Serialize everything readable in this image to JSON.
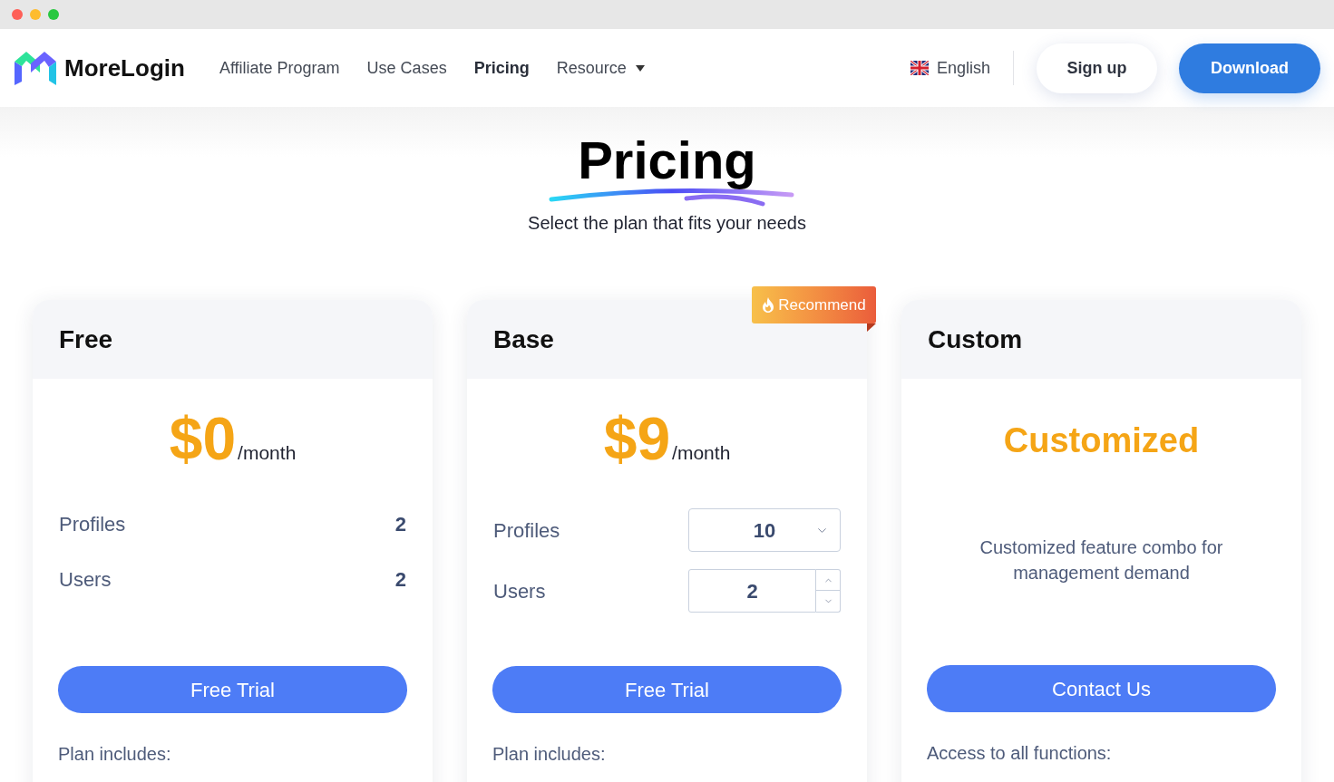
{
  "navbar": {
    "brand": "MoreLogin",
    "links": [
      {
        "label": "Affiliate Program",
        "kind": "link",
        "selected": false
      },
      {
        "label": "Use Cases",
        "kind": "link",
        "selected": false
      },
      {
        "label": "Pricing",
        "kind": "link",
        "selected": true
      },
      {
        "label": "Resource",
        "kind": "menu",
        "selected": false
      }
    ],
    "language": "English",
    "buttons": [
      {
        "label": "Sign up",
        "kind": "secondary"
      },
      {
        "label": "Download",
        "kind": "primary"
      }
    ]
  },
  "hero": {
    "title": "Pricing",
    "subtitle": "Select the plan that fits your needs"
  },
  "plans": [
    {
      "name": "Free",
      "kind": "price",
      "price": "$0",
      "period": "/month",
      "rows": [
        {
          "label": "Profiles",
          "kind": "value",
          "value": "2"
        },
        {
          "label": "Users",
          "kind": "value",
          "value": "2"
        }
      ],
      "button": "Free Trial",
      "footer": "Plan includes:"
    },
    {
      "name": "Base",
      "kind": "price",
      "badge": "Recommend",
      "price": "$9",
      "period": "/month",
      "rows": [
        {
          "label": "Profiles",
          "kind": "select",
          "value": "10"
        },
        {
          "label": "Users",
          "kind": "stepper",
          "value": "2"
        }
      ],
      "button": "Free Trial",
      "footer": "Plan includes:"
    },
    {
      "name": "Custom",
      "kind": "custom",
      "headline": "Customized",
      "description": "Customized feature combo for management demand",
      "button": "Contact Us",
      "footer": "Access to all functions:"
    }
  ]
}
